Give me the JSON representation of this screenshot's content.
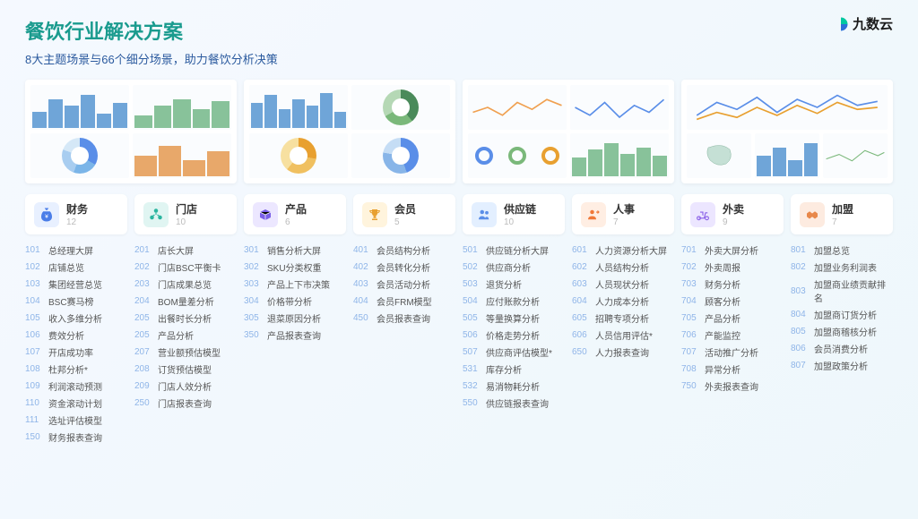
{
  "brand": {
    "name": "九数云"
  },
  "header": {
    "title": "餐饮行业解决方案",
    "subtitle": "8大主题场景与66个细分场景，助力餐饮分析决策"
  },
  "categories": [
    {
      "icon": "money-bag",
      "label": "财务",
      "count": "12",
      "bg": "#e8f0ff",
      "fg": "#4a7de8"
    },
    {
      "icon": "store",
      "label": "门店",
      "count": "10",
      "bg": "#e0f5f2",
      "fg": "#2bb5a0"
    },
    {
      "icon": "package",
      "label": "产品",
      "count": "6",
      "bg": "#ece7ff",
      "fg": "#7a5fe8"
    },
    {
      "icon": "trophy",
      "label": "会员",
      "count": "5",
      "bg": "#fff4dd",
      "fg": "#e8a030"
    },
    {
      "icon": "people",
      "label": "供应链",
      "count": "10",
      "bg": "#e3efff",
      "fg": "#5a8ee8"
    },
    {
      "icon": "user-arrow",
      "label": "人事",
      "count": "7",
      "bg": "#ffeee3",
      "fg": "#f07838"
    },
    {
      "icon": "scooter",
      "label": "外卖",
      "count": "9",
      "bg": "#ece6ff",
      "fg": "#8a60e8"
    },
    {
      "icon": "handshake",
      "label": "加盟",
      "count": "7",
      "bg": "#fdebe0",
      "fg": "#e8884a"
    }
  ],
  "columns": [
    {
      "items": [
        {
          "n": "101",
          "t": "总经理大屏"
        },
        {
          "n": "102",
          "t": "店铺总览"
        },
        {
          "n": "103",
          "t": "集团经营总览"
        },
        {
          "n": "104",
          "t": "BSC赛马榜"
        },
        {
          "n": "105",
          "t": "收入多维分析"
        },
        {
          "n": "106",
          "t": "费效分析"
        },
        {
          "n": "107",
          "t": "开店成功率"
        },
        {
          "n": "108",
          "t": "杜邦分析*"
        },
        {
          "n": "109",
          "t": "利润滚动预测"
        },
        {
          "n": "110",
          "t": "资金滚动计划"
        },
        {
          "n": "111",
          "t": "选址评估模型"
        },
        {
          "n": "150",
          "t": "财务报表查询"
        }
      ]
    },
    {
      "items": [
        {
          "n": "201",
          "t": "店长大屏"
        },
        {
          "n": "202",
          "t": "门店BSC平衡卡"
        },
        {
          "n": "203",
          "t": "门店成果总览"
        },
        {
          "n": "204",
          "t": "BOM量差分析"
        },
        {
          "n": "205",
          "t": "出餐时长分析"
        },
        {
          "n": "205",
          "t": "产品分析"
        },
        {
          "n": "207",
          "t": "营业额预估模型"
        },
        {
          "n": "208",
          "t": "订货预估模型"
        },
        {
          "n": "209",
          "t": "门店人效分析"
        },
        {
          "n": "250",
          "t": "门店报表查询"
        }
      ]
    },
    {
      "items": [
        {
          "n": "301",
          "t": "销售分析大屏"
        },
        {
          "n": "302",
          "t": "SKU分类权重"
        },
        {
          "n": "303",
          "t": "产品上下市决策"
        },
        {
          "n": "304",
          "t": "价格带分析"
        },
        {
          "n": "305",
          "t": "退菜原因分析"
        },
        {
          "n": "350",
          "t": "产品报表查询"
        }
      ]
    },
    {
      "items": [
        {
          "n": "401",
          "t": "会员结构分析"
        },
        {
          "n": "402",
          "t": "会员转化分析"
        },
        {
          "n": "403",
          "t": "会员活动分析"
        },
        {
          "n": "404",
          "t": "会员FRM模型"
        },
        {
          "n": "450",
          "t": "会员报表查询"
        }
      ]
    },
    {
      "items": [
        {
          "n": "501",
          "t": "供应链分析大屏"
        },
        {
          "n": "502",
          "t": "供应商分析"
        },
        {
          "n": "503",
          "t": "退货分析"
        },
        {
          "n": "504",
          "t": "应付账款分析"
        },
        {
          "n": "505",
          "t": "等量换算分析"
        },
        {
          "n": "506",
          "t": "价格走势分析"
        },
        {
          "n": "507",
          "t": "供应商评估模型*"
        },
        {
          "n": "531",
          "t": "库存分析"
        },
        {
          "n": "532",
          "t": "易消物耗分析"
        },
        {
          "n": "550",
          "t": "供应链报表查询"
        }
      ]
    },
    {
      "items": [
        {
          "n": "601",
          "t": "人力资源分析大屏"
        },
        {
          "n": "602",
          "t": "人员结构分析"
        },
        {
          "n": "603",
          "t": "人员现状分析"
        },
        {
          "n": "604",
          "t": "人力成本分析"
        },
        {
          "n": "605",
          "t": "招聘专项分析"
        },
        {
          "n": "606",
          "t": "人员信用评估*"
        },
        {
          "n": "650",
          "t": "人力报表查询"
        }
      ]
    },
    {
      "items": [
        {
          "n": "701",
          "t": "外卖大屏分析"
        },
        {
          "n": "702",
          "t": "外卖周报"
        },
        {
          "n": "703",
          "t": "财务分析"
        },
        {
          "n": "704",
          "t": "顾客分析"
        },
        {
          "n": "705",
          "t": "产品分析"
        },
        {
          "n": "706",
          "t": "产能监控"
        },
        {
          "n": "707",
          "t": "活动推广分析"
        },
        {
          "n": "708",
          "t": "异常分析"
        },
        {
          "n": "750",
          "t": "外卖报表查询"
        }
      ]
    },
    {
      "items": [
        {
          "n": "801",
          "t": "加盟总览"
        },
        {
          "n": "802",
          "t": "加盟业务利润表"
        },
        {
          "n": "803",
          "t": "加盟商业绩贡献排名"
        },
        {
          "n": "804",
          "t": "加盟商订货分析"
        },
        {
          "n": "805",
          "t": "加盟商稽核分析"
        },
        {
          "n": "806",
          "t": "会员消费分析"
        },
        {
          "n": "807",
          "t": "加盟政策分析"
        }
      ]
    }
  ]
}
